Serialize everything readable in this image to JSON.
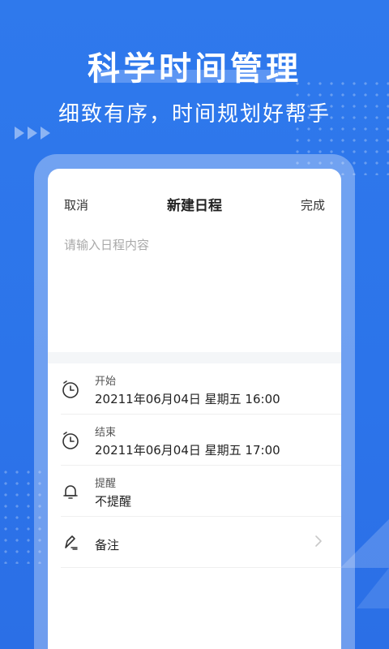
{
  "hero": {
    "title": "科学时间管理",
    "subtitle": "细致有序，时间规划好帮手"
  },
  "nav": {
    "cancel": "取消",
    "title": "新建日程",
    "done": "完成"
  },
  "content": {
    "placeholder": "请输入日程内容",
    "value": ""
  },
  "fields": {
    "start": {
      "label": "开始",
      "value": "20211年06月04日   星期五  16:00"
    },
    "end": {
      "label": "结束",
      "value": "20211年06月04日   星期五  17:00"
    },
    "reminder": {
      "label": "提醒",
      "value": "不提醒"
    },
    "note": {
      "label": "备注"
    }
  },
  "colors": {
    "background": "#2f79ec",
    "card": "#ffffff",
    "icon": "#333333"
  }
}
